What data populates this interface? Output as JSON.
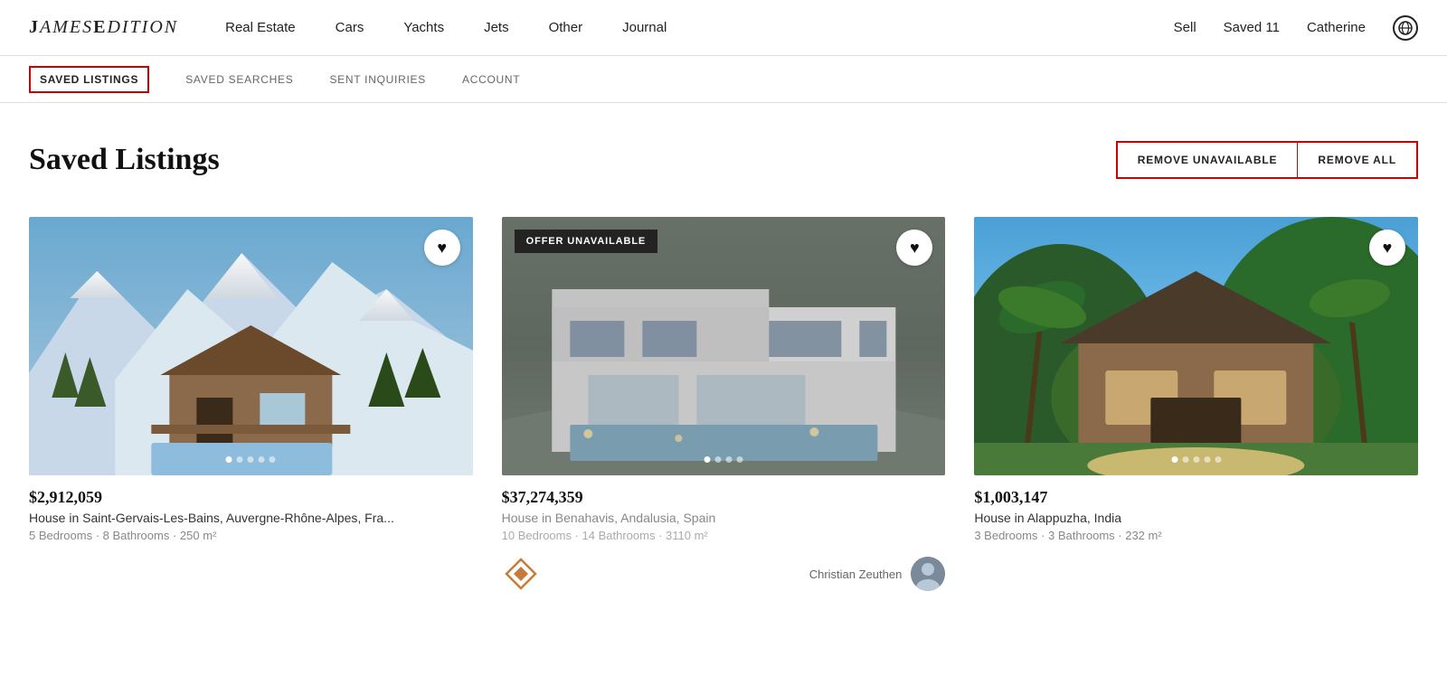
{
  "nav": {
    "logo": "JamesEdition",
    "links": [
      {
        "label": "Real Estate",
        "id": "real-estate"
      },
      {
        "label": "Cars",
        "id": "cars"
      },
      {
        "label": "Yachts",
        "id": "yachts"
      },
      {
        "label": "Jets",
        "id": "jets"
      },
      {
        "label": "Other",
        "id": "other"
      },
      {
        "label": "Journal",
        "id": "journal"
      }
    ],
    "sell_label": "Sell",
    "saved_label": "Saved 11",
    "user_label": "Catherine",
    "globe_title": "Language/Region"
  },
  "tabs": [
    {
      "label": "SAVED LISTINGS",
      "id": "saved-listings",
      "active": true
    },
    {
      "label": "SAVED SEARCHES",
      "id": "saved-searches",
      "active": false
    },
    {
      "label": "SENT INQUIRIES",
      "id": "sent-inquiries",
      "active": false
    },
    {
      "label": "ACCOUNT",
      "id": "account",
      "active": false
    }
  ],
  "page": {
    "title": "Saved Listings",
    "remove_unavailable_label": "REMOVE UNAVAILABLE",
    "remove_all_label": "REMOVE ALL"
  },
  "listings": [
    {
      "id": "listing-1",
      "price": "$2,912,059",
      "title": "House in Saint-Gervais-Les-Bains, Auvergne-Rhône-Alpes, Fra...",
      "details": "5 Bedrooms · 8 Bathrooms · 250 m²",
      "available": true,
      "dots": [
        true,
        false,
        false,
        false,
        false
      ],
      "agent_name": "",
      "agent_avatar": ""
    },
    {
      "id": "listing-2",
      "price": "$37,274,359",
      "title": "House in Benahavis, Andalusia, Spain",
      "details": "10 Bedrooms · 14 Bathrooms · 3110 m²",
      "available": false,
      "offer_badge": "OFFER UNAVAILABLE",
      "dots": [
        true,
        false,
        false,
        false
      ],
      "agent_name": "Christian Zeuthen",
      "agent_logo": true,
      "agent_avatar": true
    },
    {
      "id": "listing-3",
      "price": "$1,003,147",
      "title": "House in Alappuzha, India",
      "details": "3 Bedrooms · 3 Bathrooms · 232 m²",
      "available": true,
      "dots": [
        true,
        false,
        false,
        false,
        false
      ],
      "agent_name": "",
      "agent_avatar": ""
    }
  ]
}
